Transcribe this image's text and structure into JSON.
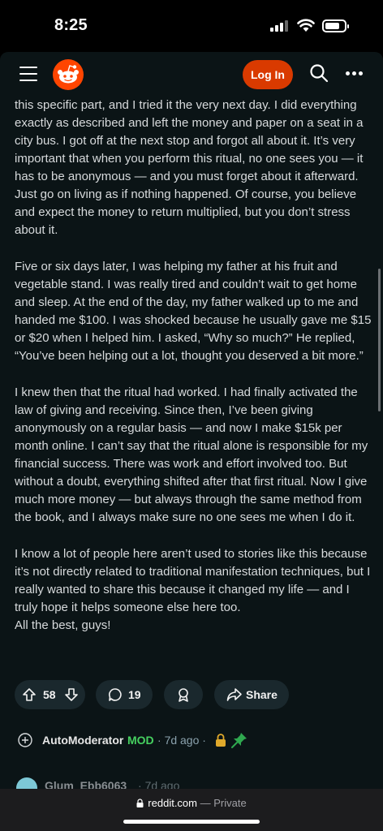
{
  "status_bar": {
    "time": "8:25",
    "battery_level": 0.75
  },
  "header": {
    "login_label": "Log In"
  },
  "post": {
    "paragraphs": [
      "this specific part, and I tried it the very next day. I did everything exactly as described and left the money and paper on a seat in a city bus. I got off at the next stop and forgot all about it. It’s very important that when you perform this ritual, no one sees you — it has to be anonymous — and you must forget about it afterward. Just go on living as if nothing happened. Of course, you believe and expect the money to return multiplied, but you don’t stress about it.",
      "Five or six days later, I was helping my father at his fruit and vegetable stand. I was really tired and couldn’t wait to get home and sleep. At the end of the day, my father walked up to me and handed me $100. I was shocked because he usually gave me $15 or $20 when I helped him. I asked, “Why so much?” He replied, “You’ve been helping out a lot, thought you deserved a bit more.”",
      "I knew then that the ritual had worked. I had finally activated the law of giving and receiving. Since then, I’ve been giving anonymously on a regular basis — and now I make $15k per month online. I can’t say that the ritual alone is responsible for my financial success. There was work and effort involved too. But without a doubt, everything shifted after that first ritual. Now I give much more money — but always through the same method from the book, and I always make sure no one sees me when I do it.",
      "I know a lot of people here aren’t used to stories like this because it’s not directly related to traditional manifestation techniques, but I really wanted to share this because it changed my life — and I truly hope it helps someone else here too."
    ],
    "signoff": "All the best, guys!",
    "vote_count": "58",
    "comment_count": "19",
    "share_label": "Share"
  },
  "comments": [
    {
      "author": "AutoModerator",
      "badge": "MOD",
      "time": "7d ago"
    },
    {
      "author": "Glum_Ebb6063",
      "time": "7d ago"
    }
  ],
  "browser": {
    "url": "reddit.com",
    "privacy": "— Private"
  },
  "colors": {
    "accent": "#d93a00",
    "background": "#0b1416",
    "mod": "#46d160",
    "pill": "#1a282d"
  }
}
